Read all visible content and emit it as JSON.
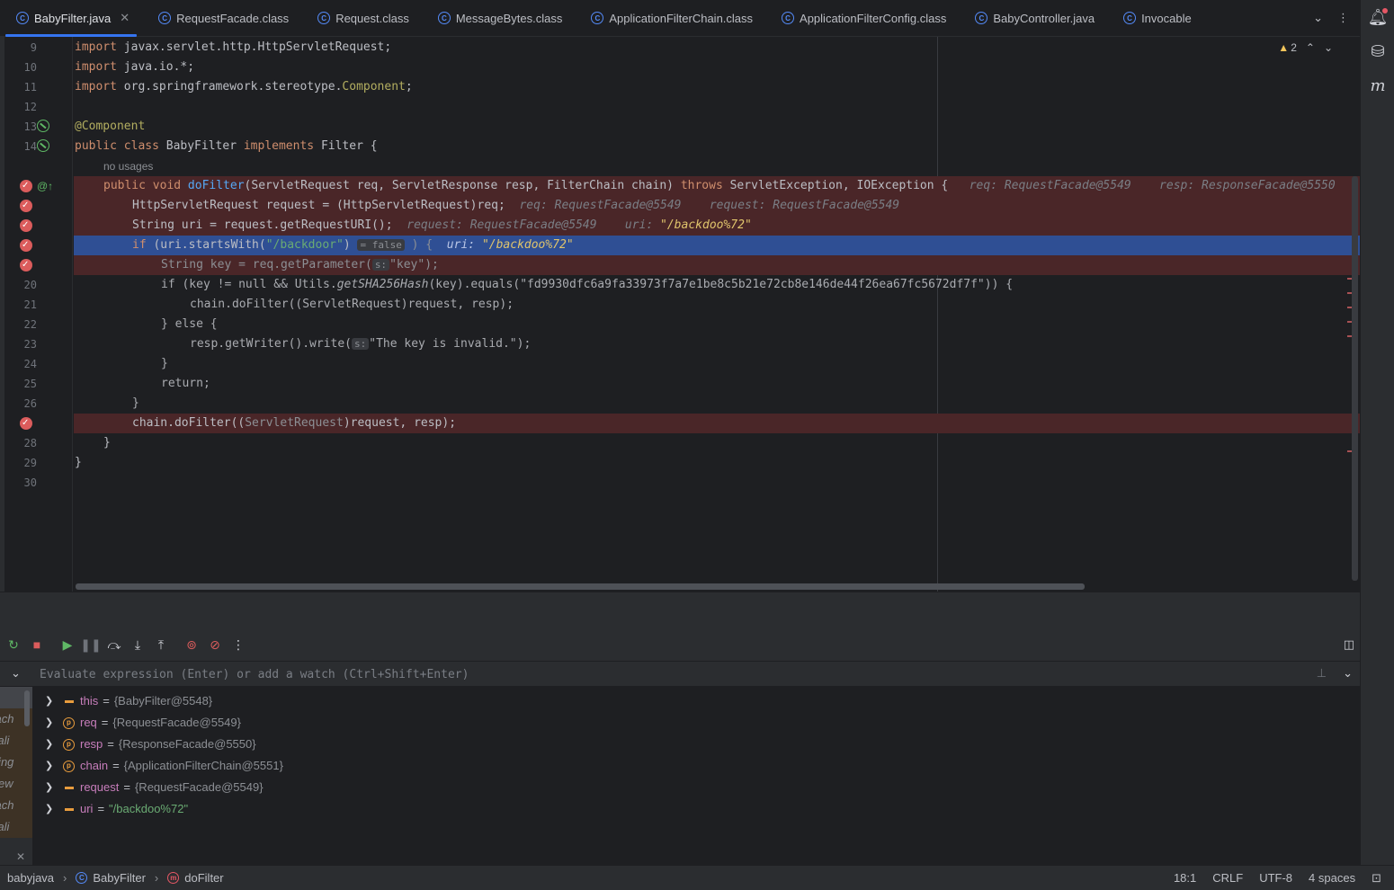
{
  "tabs": [
    {
      "label": "BabyFilter.java",
      "active": true,
      "closable": true
    },
    {
      "label": "RequestFacade.class"
    },
    {
      "label": "Request.class"
    },
    {
      "label": "MessageBytes.class"
    },
    {
      "label": "ApplicationFilterChain.class"
    },
    {
      "label": "ApplicationFilterConfig.class"
    },
    {
      "label": "BabyController.java"
    },
    {
      "label": "Invocable"
    }
  ],
  "editor": {
    "warnings_count": "2",
    "no_usages": "no usages",
    "line_numbers": [
      "9",
      "10",
      "11",
      "12",
      "13",
      "14",
      "",
      "",
      "",
      "",
      "",
      "",
      "",
      "20",
      "21",
      "22",
      "23",
      "24",
      "25",
      "26",
      "",
      "28",
      "29",
      "30"
    ]
  },
  "code": {
    "l9": [
      "import",
      " javax.servlet.http.HttpServletRequest;"
    ],
    "l10": [
      "import",
      " java.io.*;"
    ],
    "l11": [
      "import",
      " org.springframework.stereotype.",
      "Component",
      ";"
    ],
    "l13": "@Component",
    "l14": [
      "public class",
      " BabyFilter ",
      "implements",
      " Filter {"
    ],
    "l16": [
      "public void",
      " ",
      "doFilter",
      "(ServletRequest req, ServletResponse resp, FilterChain chain) ",
      "throws",
      " ServletException, IOException {",
      "req: RequestFacade@5549",
      "resp: ResponseFacade@5550"
    ],
    "l17": [
      "HttpServletRequest request = (HttpServletRequest)req;",
      "req: RequestFacade@5549",
      "request: RequestFacade@5549"
    ],
    "l18": [
      "String uri = request.getRequestURI();",
      "request: RequestFacade@5549",
      "uri: ",
      "\"/backdoo%72\""
    ],
    "l19": [
      "if",
      " (uri.startsWith(",
      "\"/backdoor\"",
      ")",
      "= false",
      " ) {",
      "uri: ",
      "\"/backdoo%72\""
    ],
    "l20": [
      "String key = req.getParameter(",
      "s:",
      "\"key\"",
      ");"
    ],
    "l21": [
      "if",
      " (key != ",
      "null",
      " && Utils.",
      "getSHA256Hash",
      "(key).equals(",
      "\"fd9930dfc6a9fa33973f7a7e1be8c5b21e72cb8e146de44f26ea67fc5672df7f\"",
      ")) {"
    ],
    "l22": "chain.doFilter((ServletRequest)request, resp);",
    "l23": [
      "} ",
      "else",
      " {"
    ],
    "l24": [
      "resp.getWriter().write(",
      "s:",
      "\"The key is invalid.\"",
      ");"
    ],
    "l25": "}",
    "l26": [
      "return",
      ";"
    ],
    "l27": "}",
    "l28": [
      "chain.doFilter((",
      "ServletRequest",
      ")request, resp);"
    ],
    "l29": "}",
    "l30": "}"
  },
  "evaluate": {
    "placeholder": "Evaluate expression (Enter) or add a watch (Ctrl+Shift+Enter)"
  },
  "frames": [
    "",
    "apach",
    "catali",
    "spring",
    "amew",
    "apach",
    "catali"
  ],
  "variables": [
    {
      "name": "this",
      "kind": "field",
      "value": "{BabyFilter@5548}"
    },
    {
      "name": "req",
      "kind": "param",
      "value": "{RequestFacade@5549}"
    },
    {
      "name": "resp",
      "kind": "param",
      "value": "{ResponseFacade@5550}"
    },
    {
      "name": "chain",
      "kind": "param",
      "value": "{ApplicationFilterChain@5551}"
    },
    {
      "name": "request",
      "kind": "field",
      "value": "{RequestFacade@5549}"
    },
    {
      "name": "uri",
      "kind": "field",
      "value": "\"/backdoo%72\""
    }
  ],
  "status": {
    "crumbs": [
      "babyjava",
      "BabyFilter",
      "doFilter"
    ],
    "position": "18:1",
    "line_ending": "CRLF",
    "encoding": "UTF-8",
    "indent": "4 spaces"
  },
  "colors": {
    "breakpoint": "#db5c5c",
    "current_line": "#2f4f94",
    "breakpoint_line": "#4a2628",
    "accent": "#3574f0"
  }
}
